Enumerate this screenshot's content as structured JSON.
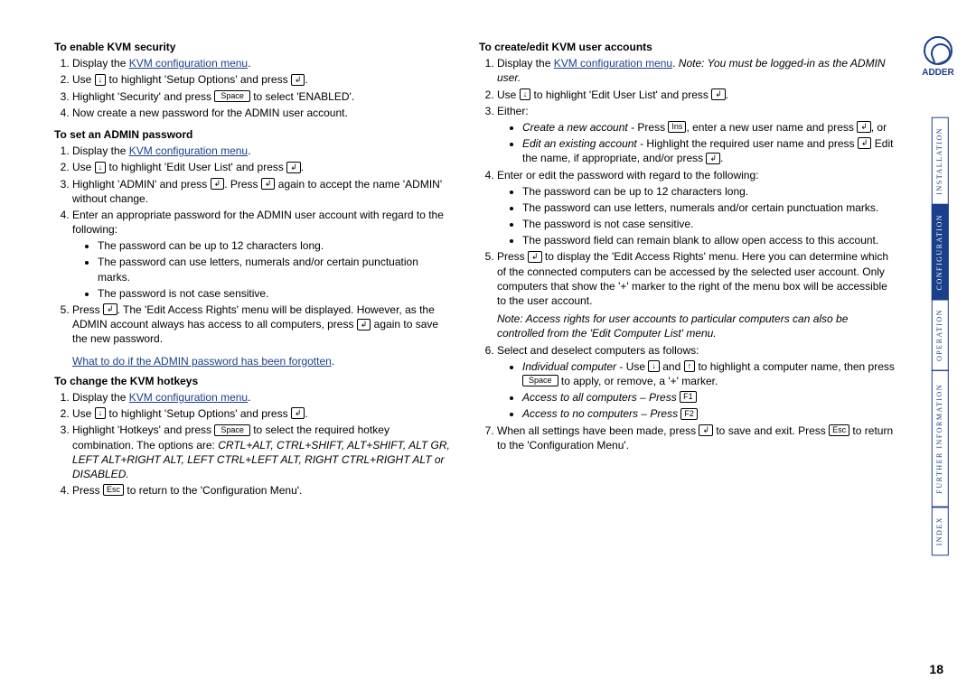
{
  "page_number": "18",
  "logo_text": "ADDER",
  "sidebar": {
    "tabs": [
      "INSTALLATION",
      "CONFIGURATION",
      "OPERATION",
      "FURTHER INFORMATION",
      "INDEX"
    ],
    "active_index": 1
  },
  "links": {
    "kvm_config_menu": "KVM configuration menu",
    "forgotten": "What to do if the ADMIN password has been forgotten"
  },
  "keys": {
    "down": "↓",
    "up": "↑",
    "enter": "↲",
    "space": "Space",
    "esc": "Esc",
    "ins": "Ins",
    "f1": "F1",
    "f2": "F2"
  },
  "left": {
    "s1": {
      "title": "To enable KVM security",
      "i1a": "Display the ",
      "i1b": ".",
      "i2a": "Use ",
      "i2b": " to highlight 'Setup Options' and press ",
      "i2c": ".",
      "i3a": "Highlight 'Security' and press ",
      "i3b": " to select 'ENABLED'.",
      "i4": "Now create a new password for the ADMIN user account."
    },
    "s2": {
      "title": "To set an ADMIN password",
      "i1a": "Display the ",
      "i1b": ".",
      "i2a": "Use ",
      "i2b": " to highlight 'Edit User List' and press ",
      "i2c": ".",
      "i3a": "Highlight 'ADMIN' and press ",
      "i3b": ". Press ",
      "i3c": " again to accept the name 'ADMIN' without change.",
      "i4": "Enter an appropriate password for the ADMIN user account with regard to the following:",
      "b1": "The password can be up to 12 characters long.",
      "b2": "The password can use letters, numerals and/or certain punctuation marks.",
      "b3": "The password is not case sensitive.",
      "i5a": "Press ",
      "i5b": ". The 'Edit Access Rights' menu will be displayed. However, as the ADMIN account always has access to all computers, press ",
      "i5c": " again to save the new password."
    },
    "s3": {
      "title": "To change the KVM hotkeys",
      "i1a": "Display the ",
      "i1b": ".",
      "i2a": "Use ",
      "i2b": " to highlight 'Setup Options' and press ",
      "i2c": ".",
      "i3a": "Highlight 'Hotkeys' and press ",
      "i3b": " to select the required hotkey combination. The options are: ",
      "i3c": "CRTL+ALT, CTRL+SHIFT, ALT+SHIFT, ALT GR, LEFT ALT+RIGHT ALT, LEFT CTRL+LEFT ALT, RIGHT CTRL+RIGHT ALT or DISABLED.",
      "i4a": "Press ",
      "i4b": " to return to the 'Configuration Menu'."
    }
  },
  "right": {
    "s1": {
      "title": "To create/edit KVM user accounts",
      "i1a": "Display the ",
      "i1b": ". ",
      "i1c": "Note: You must be logged-in as the ADMIN user.",
      "i2a": "Use ",
      "i2b": " to highlight 'Edit User List' and press ",
      "i2c": ".",
      "i3": "Either:",
      "b3a_pre": "Create a new account",
      "b3a_mid1": " - Press ",
      "b3a_mid2": ", enter a new user name and press ",
      "b3a_end": ", or",
      "b3b_pre": "Edit an existing account",
      "b3b_mid1": " - Highlight the required user name and press ",
      "b3b_mid2": " Edit the name, if appropriate, and/or press ",
      "b3b_end": ".",
      "i4": "Enter or edit the password with regard to the following:",
      "b4a": "The password can be up to 12 characters long.",
      "b4b": "The password can use letters, numerals and/or certain punctuation marks.",
      "b4c": "The password is not case sensitive.",
      "b4d": "The password field can remain blank to allow open access to this account.",
      "i5a": "Press ",
      "i5b": " to display the 'Edit Access Rights' menu. Here you can determine which of the connected computers can be accessed by the selected user account. Only computers that show the '+' marker to the right of the menu box will be accessible to the user account.",
      "i5note": "Note: Access rights for user accounts to particular computers can also be controlled from the 'Edit Computer List' menu.",
      "i6": "Select and deselect computers as follows:",
      "b6a_pre": "Individual computer",
      "b6a_mid1": " - Use ",
      "b6a_mid2": " and ",
      "b6a_mid3": " to highlight a computer name, then press ",
      "b6a_end": " to apply, or remove, a '+' marker.",
      "b6b_pre": "Access to all computers",
      "b6b_mid": " – Press ",
      "b6c_pre": "Access to no computers",
      "b6c_mid": " – Press ",
      "i7a": "When all settings have been made, press ",
      "i7b": " to save and exit. Press ",
      "i7c": " to return to the 'Configuration Menu'."
    }
  }
}
